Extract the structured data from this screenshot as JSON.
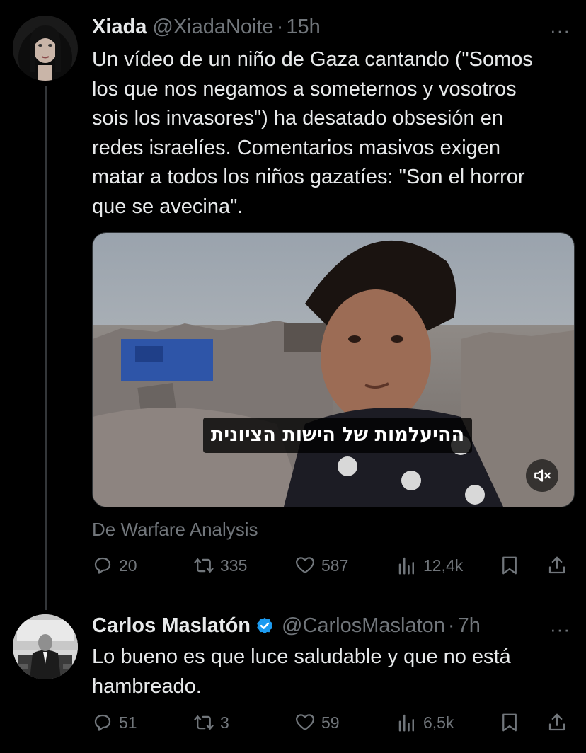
{
  "tweets": [
    {
      "name": "Xiada",
      "handle": "@XiadaNoite",
      "time": "15h",
      "more": "···",
      "lines": [
        "Un vídeo de un niño de Gaza cantando (\"Somos",
        "los que nos negamos a someternos y vosotros",
        "sois los invasores\") ha desatado obsesión en",
        "redes israelíes. Comentarios masivos exigen",
        "matar a todos los niños gazatíes: \"Son el horror",
        "que se avecina\"."
      ],
      "media": {
        "caption": "ההיעלמות של הישות הציונית",
        "mute_icon": "mute-icon"
      },
      "attribution": "De Warfare Analysis",
      "stats": {
        "replies": "20",
        "reposts": "335",
        "likes": "587",
        "views": "12,4k"
      }
    },
    {
      "name": "Carlos Maslatón",
      "handle": "@CarlosMaslaton",
      "time": "7h",
      "more": "···",
      "verified": true,
      "lines": [
        "Lo bueno es que luce saludable y que no está",
        "hambreado."
      ],
      "stats": {
        "replies": "51",
        "reposts": "3",
        "likes": "59",
        "views": "6,5k"
      }
    }
  ],
  "colors": {
    "background": "#000000",
    "text": "#e7e9ea",
    "muted": "#71767b",
    "verified": "#1d9bf0"
  }
}
